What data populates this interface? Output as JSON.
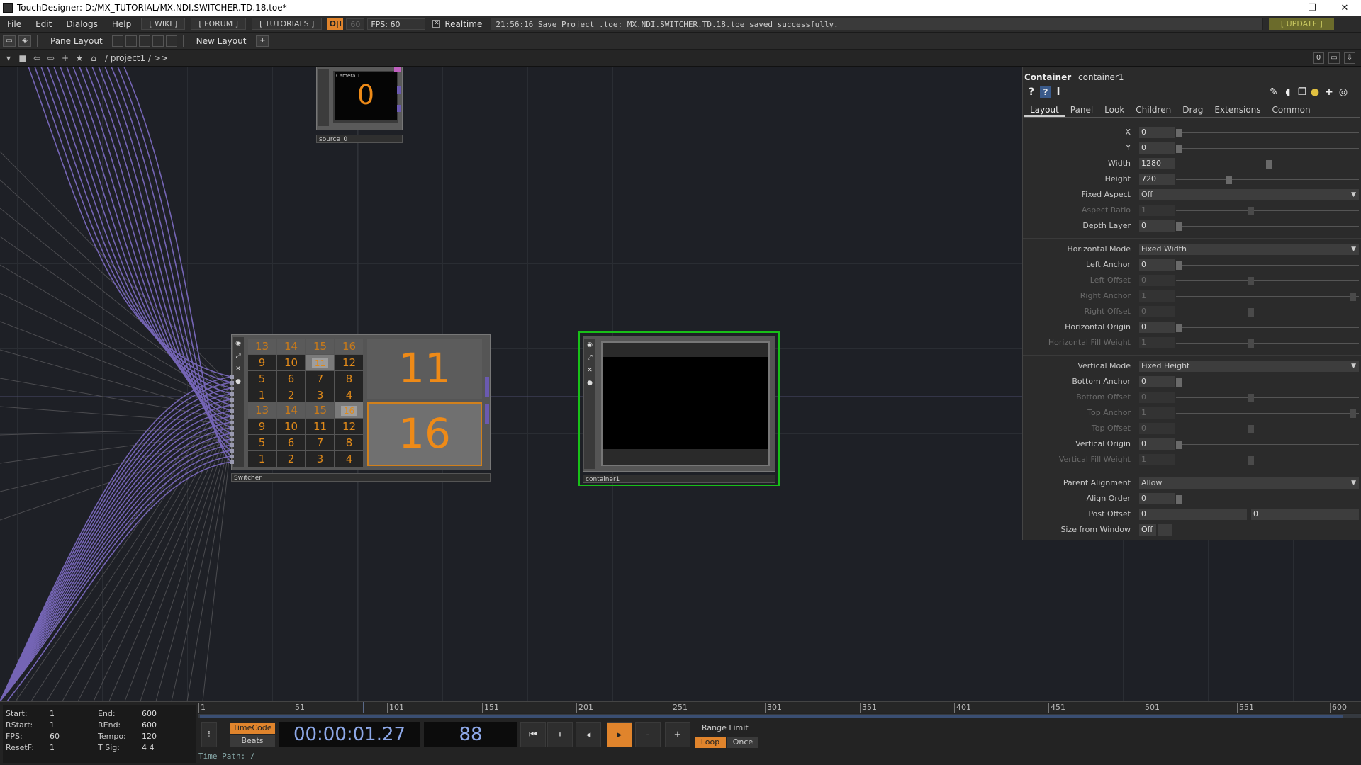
{
  "window": {
    "title": "TouchDesigner: D:/MX_TUTORIAL/MX.NDI.SWITCHER.TD.18.toe*",
    "min": "—",
    "max": "❐",
    "close": "✕"
  },
  "menu": {
    "items": [
      "File",
      "Edit",
      "Dialogs",
      "Help"
    ],
    "links": [
      "[ WIKI ]",
      "[ FORUM ]",
      "[ TUTORIALS ]"
    ],
    "rt_box": "O|I",
    "fps_max": "60",
    "fps": "FPS:  60",
    "realtime_label": "Realtime",
    "status": "21:56:16 Save Project .toe: MX.NDI.SWITCHER.TD.18.toe saved successfully.",
    "update": "[ UPDATE ]"
  },
  "toolbar": {
    "pane_layout": "Pane Layout",
    "new_layout": "New Layout",
    "add": "+"
  },
  "path": {
    "text": "/ project1 / >>",
    "right_counter": "0"
  },
  "nodes": {
    "source": {
      "name": "source_0",
      "label": "Camera 1",
      "value": "0"
    },
    "switcher": {
      "name": "Switcher",
      "top_value": "11",
      "bottom_value": "16",
      "grid_top": [
        [
          "13",
          "14",
          "15",
          "16"
        ],
        [
          "9",
          "10",
          "11",
          "12"
        ],
        [
          "5",
          "6",
          "7",
          "8"
        ],
        [
          "1",
          "2",
          "3",
          "4"
        ]
      ],
      "grid_bottom": [
        [
          "13",
          "14",
          "15",
          "16"
        ],
        [
          "9",
          "10",
          "11",
          "12"
        ],
        [
          "5",
          "6",
          "7",
          "8"
        ],
        [
          "1",
          "2",
          "3",
          "4"
        ]
      ]
    },
    "container": {
      "name": "container1"
    }
  },
  "params": {
    "type": "Container",
    "name": "container1",
    "tabs": [
      "Layout",
      "Panel",
      "Look",
      "Children",
      "Drag",
      "Extensions",
      "Common"
    ],
    "rows": [
      {
        "label": "X",
        "value": "0",
        "kind": "slider",
        "knob": 0,
        "disabled": false
      },
      {
        "label": "Y",
        "value": "0",
        "kind": "slider",
        "knob": 0,
        "disabled": false
      },
      {
        "label": "Width",
        "value": "1280",
        "kind": "slider",
        "knob": 0.5,
        "disabled": false
      },
      {
        "label": "Height",
        "value": "720",
        "kind": "slider",
        "knob": 0.28,
        "disabled": false
      },
      {
        "label": "Fixed Aspect",
        "value": "Off",
        "kind": "menu",
        "disabled": false
      },
      {
        "label": "Aspect Ratio",
        "value": "1",
        "kind": "slider",
        "knob": 0.4,
        "disabled": true
      },
      {
        "label": "Depth Layer",
        "value": "0",
        "kind": "slider",
        "knob": 0,
        "disabled": false
      },
      {
        "label": "Horizontal Mode",
        "value": "Fixed Width",
        "kind": "menu",
        "disabled": false,
        "sep": true
      },
      {
        "label": "Left Anchor",
        "value": "0",
        "kind": "slider",
        "knob": 0,
        "disabled": false
      },
      {
        "label": "Left Offset",
        "value": "0",
        "kind": "slider",
        "knob": 0.4,
        "disabled": true
      },
      {
        "label": "Right Anchor",
        "value": "1",
        "kind": "slider",
        "knob": 0.97,
        "disabled": true
      },
      {
        "label": "Right Offset",
        "value": "0",
        "kind": "slider",
        "knob": 0.4,
        "disabled": true
      },
      {
        "label": "Horizontal Origin",
        "value": "0",
        "kind": "slider",
        "knob": 0,
        "disabled": false
      },
      {
        "label": "Horizontal Fill Weight",
        "value": "1",
        "kind": "slider",
        "knob": 0.4,
        "disabled": true
      },
      {
        "label": "Vertical Mode",
        "value": "Fixed Height",
        "kind": "menu",
        "disabled": false,
        "sep": true
      },
      {
        "label": "Bottom Anchor",
        "value": "0",
        "kind": "slider",
        "knob": 0,
        "disabled": false
      },
      {
        "label": "Bottom Offset",
        "value": "0",
        "kind": "slider",
        "knob": 0.4,
        "disabled": true
      },
      {
        "label": "Top Anchor",
        "value": "1",
        "kind": "slider",
        "knob": 0.97,
        "disabled": true
      },
      {
        "label": "Top Offset",
        "value": "0",
        "kind": "slider",
        "knob": 0.4,
        "disabled": true
      },
      {
        "label": "Vertical Origin",
        "value": "0",
        "kind": "slider",
        "knob": 0,
        "disabled": false
      },
      {
        "label": "Vertical Fill Weight",
        "value": "1",
        "kind": "slider",
        "knob": 0.4,
        "disabled": true
      },
      {
        "label": "Parent Alignment",
        "value": "Allow",
        "kind": "menu",
        "disabled": false,
        "sep": true
      },
      {
        "label": "Align Order",
        "value": "0",
        "kind": "slider",
        "knob": 0,
        "disabled": false
      },
      {
        "label": "Post Offset",
        "value": "0",
        "value2": "0",
        "kind": "pair",
        "disabled": false
      },
      {
        "label": "Size from Window",
        "value": "Off",
        "kind": "toggle",
        "disabled": false
      }
    ]
  },
  "timeline": {
    "info": [
      [
        "Start:",
        "1",
        "End:",
        "600"
      ],
      [
        "RStart:",
        "1",
        "REnd:",
        "600"
      ],
      [
        "FPS:",
        "60",
        "Tempo:",
        "120"
      ],
      [
        "ResetF:",
        "1",
        "T Sig:",
        "4     4"
      ]
    ],
    "ticks": [
      "1",
      "51",
      "101",
      "151",
      "201",
      "251",
      "301",
      "351",
      "401",
      "451",
      "501",
      "551",
      "600"
    ],
    "timecode_btn": "TimeCode",
    "beats_btn": "Beats",
    "timecode": "00:00:01.27",
    "frame": "88",
    "range_label": "Range Limit",
    "loop": "Loop",
    "once": "Once",
    "time_path": "Time Path: /",
    "minus": "-",
    "plus": "+"
  }
}
